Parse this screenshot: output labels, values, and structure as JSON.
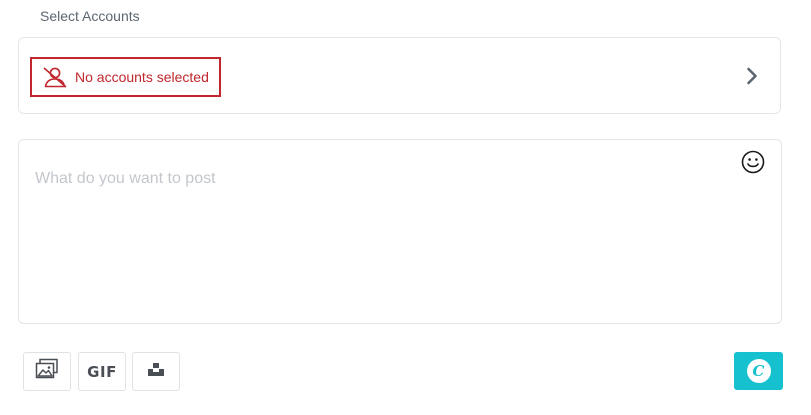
{
  "accounts": {
    "label": "Select Accounts",
    "empty_text": "No accounts selected",
    "empty_icon": "user-off-icon",
    "expand_icon": "chevron-right-icon"
  },
  "composer": {
    "placeholder": "What do you want to post",
    "emoji_icon": "smiley-icon"
  },
  "toolbar": {
    "media_icon": "image-gallery-icon",
    "gif_label": "GIF",
    "unsplash_icon": "unsplash-icon",
    "canva_letter": "C"
  },
  "colors": {
    "error": "#c1272d",
    "canva": "#16c1cf",
    "border": "#e3e6ea"
  }
}
